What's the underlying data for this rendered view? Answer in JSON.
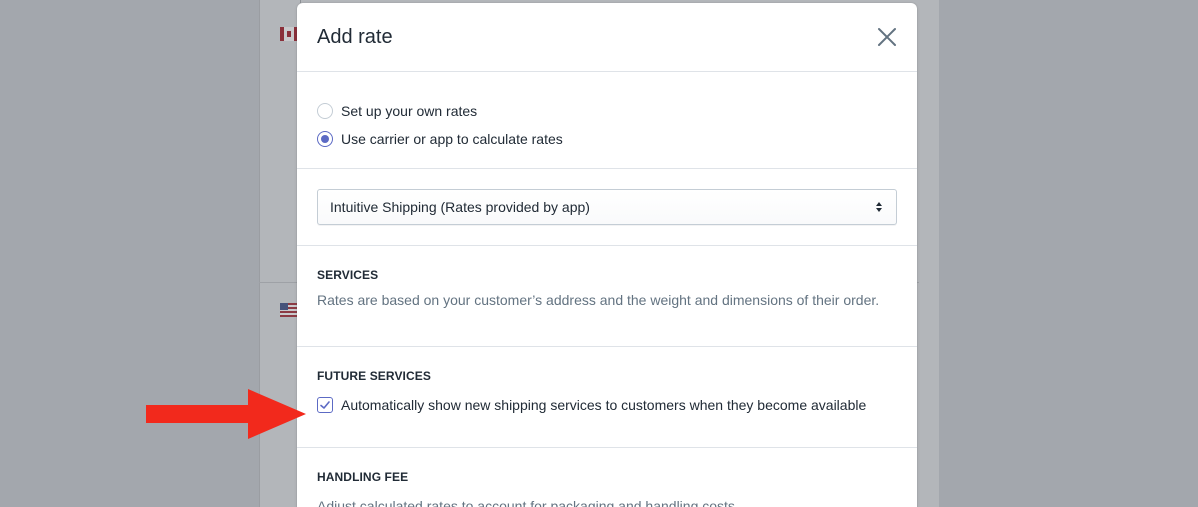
{
  "modal": {
    "title": "Add rate",
    "close_icon": "close-icon"
  },
  "rate_type": {
    "options": [
      {
        "label": "Set up your own rates",
        "checked": false
      },
      {
        "label": "Use carrier or app to calculate rates",
        "checked": true
      }
    ]
  },
  "carrier_select": {
    "value": "Intuitive Shipping (Rates provided by app)"
  },
  "services": {
    "heading": "SERVICES",
    "description": "Rates are based on your customer’s address and the weight and dimensions of their order."
  },
  "future_services": {
    "heading": "FUTURE SERVICES",
    "checkbox_label": "Automatically show new shipping services to customers when they become available",
    "checked": true
  },
  "handling_fee": {
    "heading": "HANDLING FEE",
    "description": "Adjust calculated rates to account for packaging and handling costs."
  },
  "colors": {
    "accent": "#5c6ac4",
    "annotation_arrow": "#f2291c"
  }
}
